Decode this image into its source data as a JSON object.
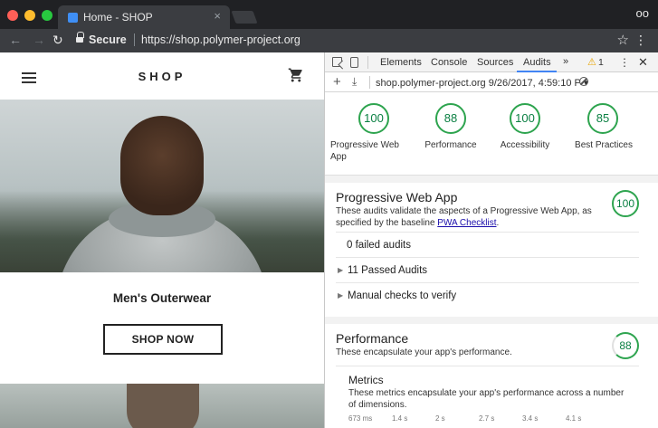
{
  "browser": {
    "tab_title": "Home - SHOP",
    "tab_close": "×",
    "secure_label": "Secure",
    "url": "https://shop.polymer-project.org",
    "back": "←",
    "forward": "→",
    "reload": "↻",
    "star": "☆",
    "menu": "⋮",
    "incognito": "oo"
  },
  "page": {
    "logo": "SHOP",
    "category_title": "Men's Outerwear",
    "shop_now": "SHOP NOW"
  },
  "devtools": {
    "tabs": [
      "Elements",
      "Console",
      "Sources",
      "Audits"
    ],
    "active_tab": "Audits",
    "more": "»",
    "warn_icon": "⚠",
    "warn_count": "1",
    "kebab": "⋮",
    "close": "✕",
    "subbar": {
      "plus": "+",
      "download": "⤓",
      "report": "shop.polymer-project.org 9/26/2017, 4:59:10 P ▾"
    },
    "scores": [
      {
        "value": "100",
        "label": "Progressive Web App"
      },
      {
        "value": "88",
        "label": "Performance"
      },
      {
        "value": "100",
        "label": "Accessibility"
      },
      {
        "value": "85",
        "label": "Best Practices"
      }
    ],
    "pwa": {
      "title": "Progressive Web App",
      "desc": "These audits validate the aspects of a Progressive Web App, as specified by the baseline ",
      "link": "PWA Checklist",
      "desc_end": ".",
      "score": "100",
      "rows": [
        "0 failed audits",
        "11 Passed Audits",
        "Manual checks to verify"
      ]
    },
    "performance": {
      "title": "Performance",
      "desc": "These encapsulate your app's performance.",
      "score": "88",
      "metrics_title": "Metrics",
      "metrics_desc": "These metrics encapsulate your app's performance across a number of dimensions.",
      "filmstrip": [
        "673 ms",
        "1.4 s",
        "2 s",
        "2.7 s",
        "3.4 s",
        "4.1 s"
      ]
    },
    "colors": {
      "score_green": "#2ea44f",
      "tab_accent": "#4285f4"
    }
  }
}
